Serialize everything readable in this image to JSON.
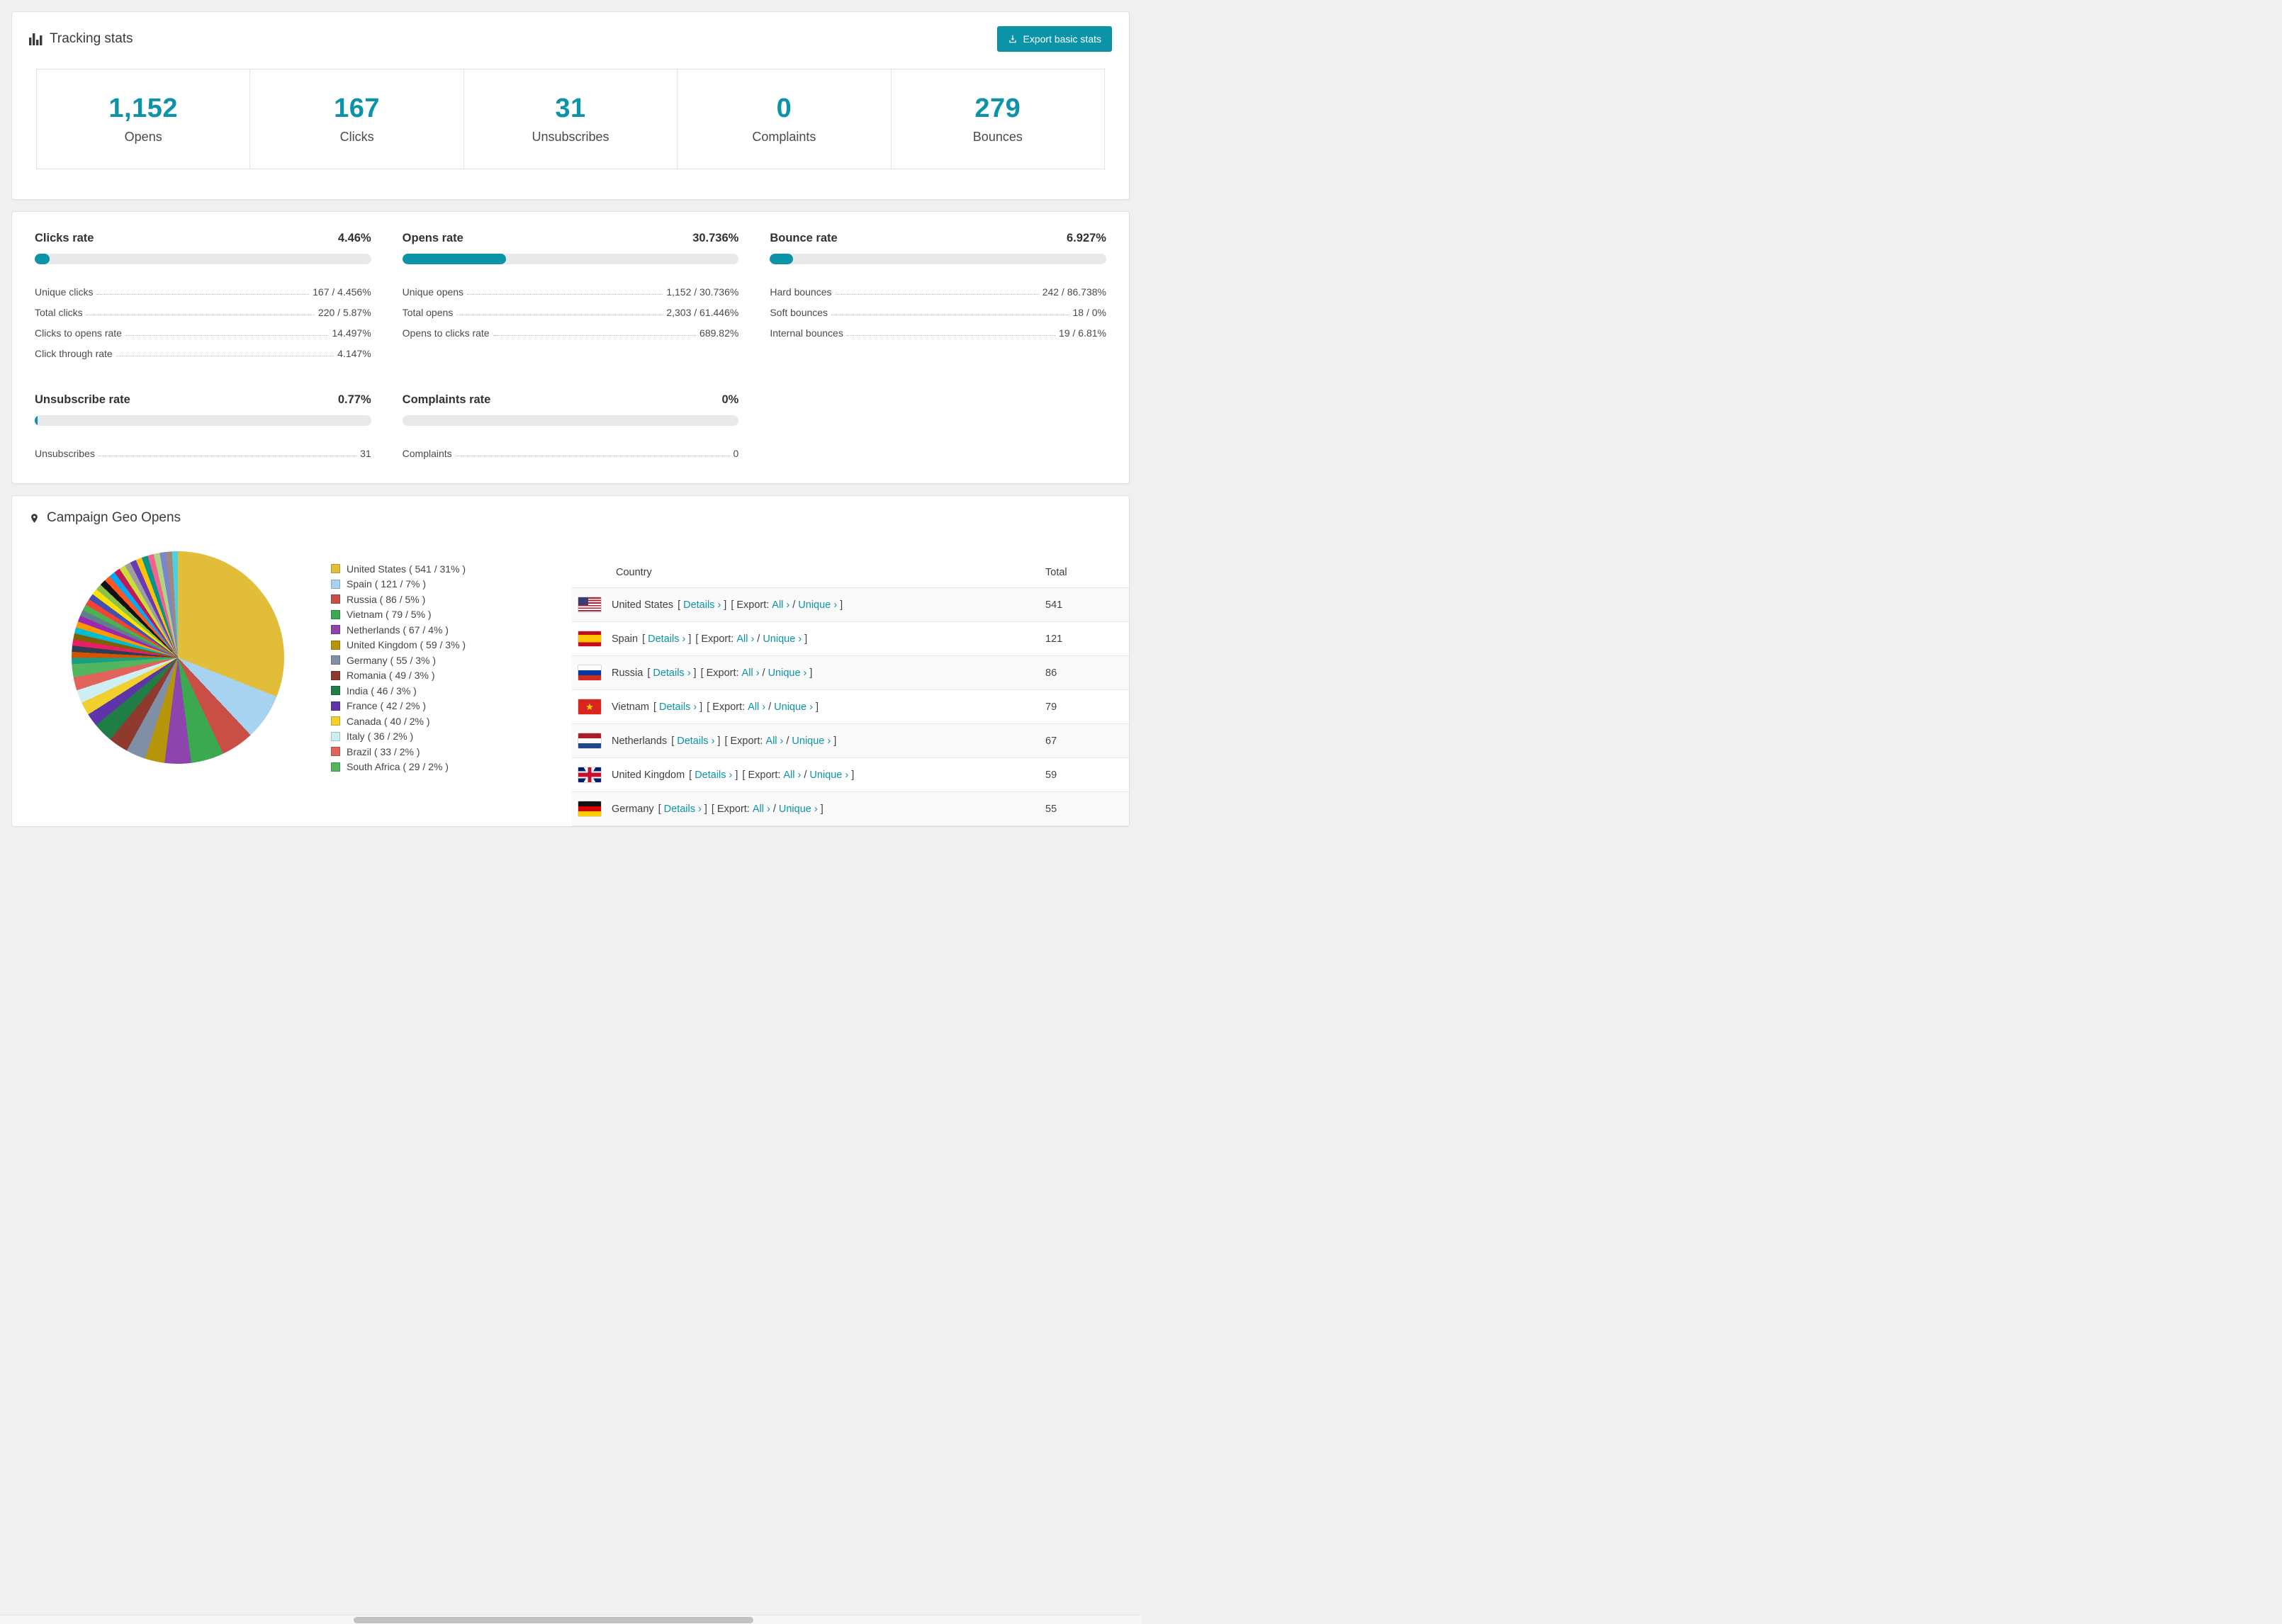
{
  "accent_color": "#0b93a8",
  "tracking": {
    "title": "Tracking stats",
    "export_button": "Export basic stats",
    "stats": [
      {
        "value": "1,152",
        "label": "Opens"
      },
      {
        "value": "167",
        "label": "Clicks"
      },
      {
        "value": "31",
        "label": "Unsubscribes"
      },
      {
        "value": "0",
        "label": "Complaints"
      },
      {
        "value": "279",
        "label": "Bounces"
      }
    ]
  },
  "rates": {
    "panels": [
      {
        "title": "Clicks rate",
        "value": "4.46%",
        "rows": [
          {
            "label": "Unique clicks",
            "value": "167 / 4.456%"
          },
          {
            "label": "Total clicks",
            "value": "220 / 5.87%"
          },
          {
            "label": "Clicks to opens rate",
            "value": "14.497%"
          },
          {
            "label": "Click through rate",
            "value": "4.147%"
          }
        ]
      },
      {
        "title": "Opens rate",
        "value": "30.736%",
        "rows": [
          {
            "label": "Unique opens",
            "value": "1,152 / 30.736%"
          },
          {
            "label": "Total opens",
            "value": "2,303 / 61.446%"
          },
          {
            "label": "Opens to clicks rate",
            "value": "689.82%"
          }
        ]
      },
      {
        "title": "Bounce rate",
        "value": "6.927%",
        "rows": [
          {
            "label": "Hard bounces",
            "value": "242 / 86.738%"
          },
          {
            "label": "Soft bounces",
            "value": "18 / 0%"
          },
          {
            "label": "Internal bounces",
            "value": "19 / 6.81%"
          }
        ]
      },
      {
        "title": "Unsubscribe rate",
        "value": "0.77%",
        "rows": [
          {
            "label": "Unsubscribes",
            "value": "31"
          }
        ]
      },
      {
        "title": "Complaints rate",
        "value": "0%",
        "rows": [
          {
            "label": "Complaints",
            "value": "0"
          }
        ]
      }
    ]
  },
  "geo": {
    "title": "Campaign Geo Opens",
    "legend": [
      "United States ( 541 / 31% )",
      "Spain ( 121 / 7% )",
      "Russia ( 86 / 5% )",
      "Vietnam ( 79 / 5% )",
      "Netherlands ( 67 / 4% )",
      "United Kingdom ( 59 / 3% )",
      "Germany ( 55 / 3% )",
      "Romania ( 49 / 3% )",
      "India ( 46 / 3% )",
      "France ( 42 / 2% )",
      "Canada ( 40 / 2% )",
      "Italy ( 36 / 2% )",
      "Brazil ( 33 / 2% )",
      "South Africa ( 29 / 2% )"
    ],
    "links": {
      "lb": "[",
      "rb": "]",
      "details": "Details ›",
      "export": "Export:",
      "all": "All ›",
      "slash": "/",
      "unique": "Unique ›"
    },
    "table": {
      "headers": {
        "country": "Country",
        "total": "Total"
      },
      "rows": [
        {
          "flag": "us",
          "country": "United States",
          "total": "541"
        },
        {
          "flag": "es",
          "country": "Spain",
          "total": "121"
        },
        {
          "flag": "ru",
          "country": "Russia",
          "total": "86"
        },
        {
          "flag": "vn",
          "country": "Vietnam",
          "total": "79"
        },
        {
          "flag": "nl",
          "country": "Netherlands",
          "total": "67"
        },
        {
          "flag": "gb",
          "country": "United Kingdom",
          "total": "59"
        },
        {
          "flag": "de",
          "country": "Germany",
          "total": "55"
        }
      ]
    },
    "chart_data": {
      "type": "pie",
      "title": "Campaign Geo Opens",
      "legend_position": "right",
      "slices": [
        {
          "label": "United States",
          "value": 541,
          "pct": 31,
          "color": "#e2bd3a"
        },
        {
          "label": "Spain",
          "value": 121,
          "pct": 7,
          "color": "#a8d3f0"
        },
        {
          "label": "Russia",
          "value": 86,
          "pct": 5,
          "color": "#c94f46"
        },
        {
          "label": "Vietnam",
          "value": 79,
          "pct": 5,
          "color": "#3ba94f"
        },
        {
          "label": "Netherlands",
          "value": 67,
          "pct": 4,
          "color": "#8e44ad"
        },
        {
          "label": "United Kingdom",
          "value": 59,
          "pct": 3,
          "color": "#b7950b"
        },
        {
          "label": "Germany",
          "value": 55,
          "pct": 3,
          "color": "#7f8fa6"
        },
        {
          "label": "Romania",
          "value": 49,
          "pct": 3,
          "color": "#8e3a2f"
        },
        {
          "label": "India",
          "value": 46,
          "pct": 3,
          "color": "#1e7e46"
        },
        {
          "label": "France",
          "value": 42,
          "pct": 2,
          "color": "#5e35a8"
        },
        {
          "label": "Canada",
          "value": 40,
          "pct": 2,
          "color": "#f1d02e"
        },
        {
          "label": "Italy",
          "value": 36,
          "pct": 2,
          "color": "#cdeef2"
        },
        {
          "label": "Brazil",
          "value": 33,
          "pct": 2,
          "color": "#e2635c"
        },
        {
          "label": "South Africa",
          "value": 29,
          "pct": 2,
          "color": "#53b65f"
        }
      ],
      "other_slices": [
        {
          "pct": 0.93,
          "color": "#16a085"
        },
        {
          "pct": 0.93,
          "color": "#d35400"
        },
        {
          "pct": 0.93,
          "color": "#2c3e50"
        },
        {
          "pct": 0.93,
          "color": "#e91e63"
        },
        {
          "pct": 0.93,
          "color": "#7f6000"
        },
        {
          "pct": 0.93,
          "color": "#00bcd4"
        },
        {
          "pct": 0.93,
          "color": "#ff9800"
        },
        {
          "pct": 0.93,
          "color": "#9c27b0"
        },
        {
          "pct": 0.93,
          "color": "#607d8b"
        },
        {
          "pct": 0.93,
          "color": "#4caf50"
        },
        {
          "pct": 0.93,
          "color": "#f44336"
        },
        {
          "pct": 0.93,
          "color": "#3f51b5"
        },
        {
          "pct": 0.93,
          "color": "#ffe100"
        },
        {
          "pct": 0.93,
          "color": "#8bc34a"
        },
        {
          "pct": 0.93,
          "color": "#111111"
        },
        {
          "pct": 0.93,
          "color": "#ff5722"
        },
        {
          "pct": 0.93,
          "color": "#03a9f4"
        },
        {
          "pct": 0.93,
          "color": "#c2185b"
        },
        {
          "pct": 0.93,
          "color": "#cddc39"
        },
        {
          "pct": 0.93,
          "color": "#9e9e9e"
        },
        {
          "pct": 0.93,
          "color": "#673ab7"
        },
        {
          "pct": 0.93,
          "color": "#ffc107"
        },
        {
          "pct": 0.93,
          "color": "#009688"
        },
        {
          "pct": 0.93,
          "color": "#f06292"
        },
        {
          "pct": 0.93,
          "color": "#aed581"
        },
        {
          "pct": 0.93,
          "color": "#7986cb"
        },
        {
          "pct": 0.93,
          "color": "#a1887f"
        },
        {
          "pct": 0.93,
          "color": "#4dd0e1"
        }
      ]
    }
  }
}
